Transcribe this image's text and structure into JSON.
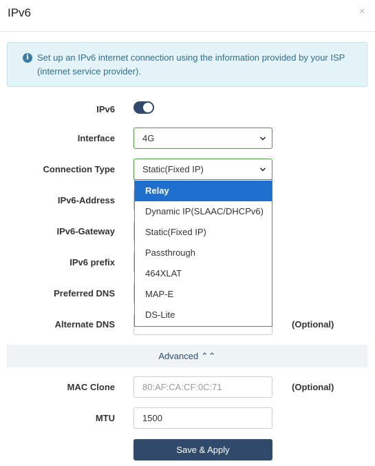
{
  "dialog": {
    "title": "IPv6",
    "close_label": "×"
  },
  "info": {
    "text": "Set up an IPv6 internet connection using the information provided by your ISP (internet service provider)."
  },
  "form": {
    "ipv6": {
      "label": "IPv6",
      "enabled": true
    },
    "interface": {
      "label": "Interface",
      "value": "4G"
    },
    "connection_type": {
      "label": "Connection Type",
      "value": "Static(Fixed IP)",
      "options": [
        "Relay",
        "Dynamic IP(SLAAC/DHCPv6)",
        "Static(Fixed IP)",
        "Passthrough",
        "464XLAT",
        "MAP-E",
        "DS-Lite"
      ],
      "highlighted": "Relay"
    },
    "ipv6_address": {
      "label": "IPv6-Address"
    },
    "ipv6_gateway": {
      "label": "IPv6-Gateway"
    },
    "ipv6_prefix": {
      "label": "IPv6 prefix"
    },
    "preferred_dns": {
      "label": "Preferred DNS"
    },
    "alternate_dns": {
      "label": "Alternate DNS",
      "optional": "(Optional)"
    }
  },
  "advanced": {
    "label": "Advanced ⌃⌃"
  },
  "advanced_form": {
    "mac_clone": {
      "label": "MAC Clone",
      "placeholder": "80:AF:CA:CF:0C:71",
      "optional": "(Optional)"
    },
    "mtu": {
      "label": "MTU",
      "value": "1500"
    }
  },
  "actions": {
    "save_label": "Save & Apply"
  },
  "colors": {
    "primary": "#2f4a6b",
    "highlight": "#1f6fce",
    "info_bg": "#e3f3f8",
    "valid_border": "#4e9a44"
  }
}
